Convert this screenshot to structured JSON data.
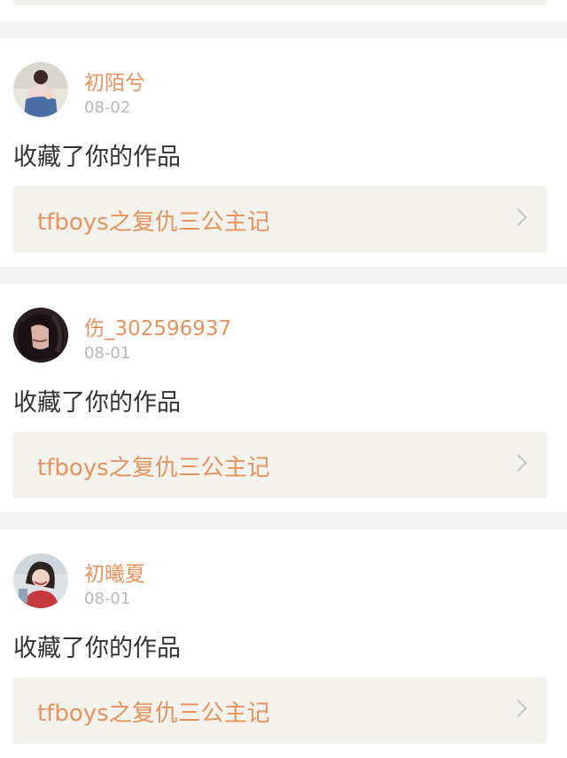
{
  "feed": [
    {
      "username": "初陌兮",
      "date": "08-02",
      "action": "收藏了你的作品",
      "work_title": "tfboys之复仇三公主记",
      "avatar_icon": "user-photo-girl-sitting"
    },
    {
      "username": "伤_302596937",
      "date": "08-01",
      "action": "收藏了你的作品",
      "work_title": "tfboys之复仇三公主记",
      "avatar_icon": "user-photo-dark-portrait"
    },
    {
      "username": "初曦夏",
      "date": "08-01",
      "action": "收藏了你的作品",
      "work_title": "tfboys之复仇三公主记",
      "avatar_icon": "user-photo-smiling-girl"
    }
  ],
  "colors": {
    "accent": "#e8935f",
    "muted": "#b8b8b8",
    "text": "#333333",
    "link_bg": "#f3f2ed",
    "page_bg": "#f4f4f4"
  }
}
